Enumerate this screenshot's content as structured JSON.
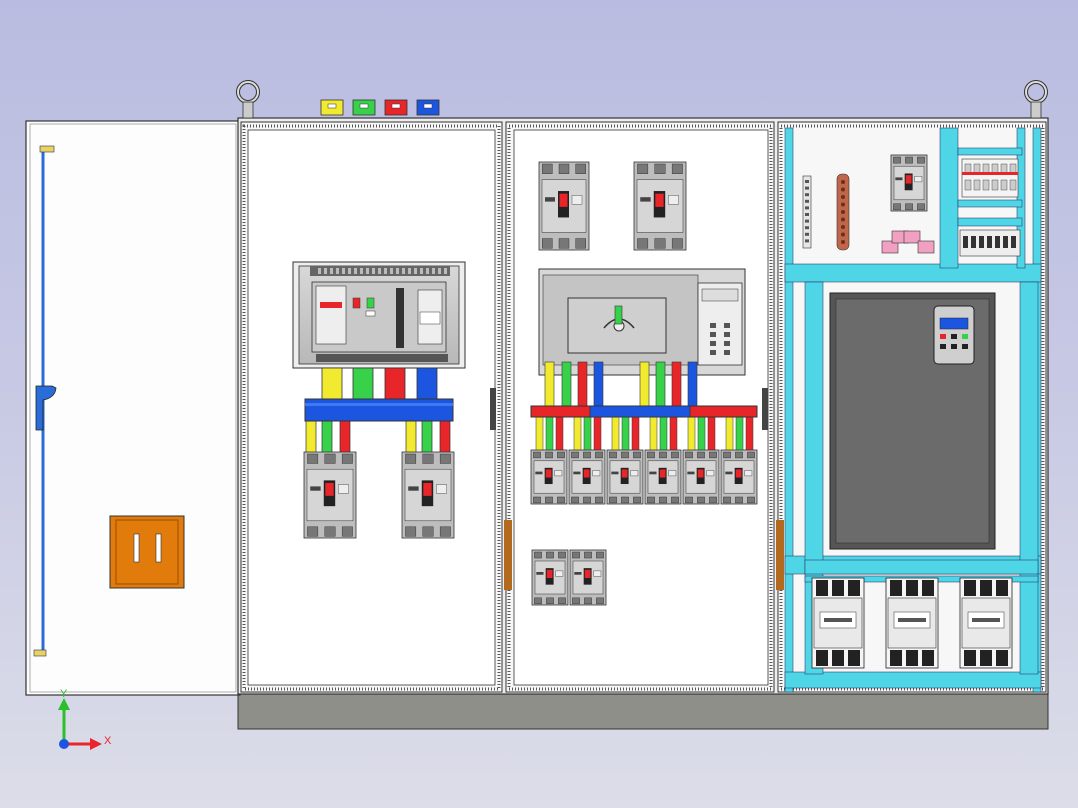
{
  "scene": {
    "cabinet_count": 3,
    "door": "left-open"
  },
  "phase_colors": [
    "#f2ea2e",
    "#38d24a",
    "#e8262a",
    "#1c56e0"
  ],
  "bus_colors": {
    "left_busbar": "#1c56e0",
    "middle_busbar": "#e8262a",
    "mounting_rail": "#4fd6e6",
    "door_handle": "#e07b0c"
  },
  "triad": {
    "x_label": "X",
    "y_label": "Y"
  },
  "icons": [
    "lifting-eye-icon",
    "breaker-icon",
    "contactor-icon",
    "vfd-keypad-icon",
    "axis-triad-icon"
  ]
}
